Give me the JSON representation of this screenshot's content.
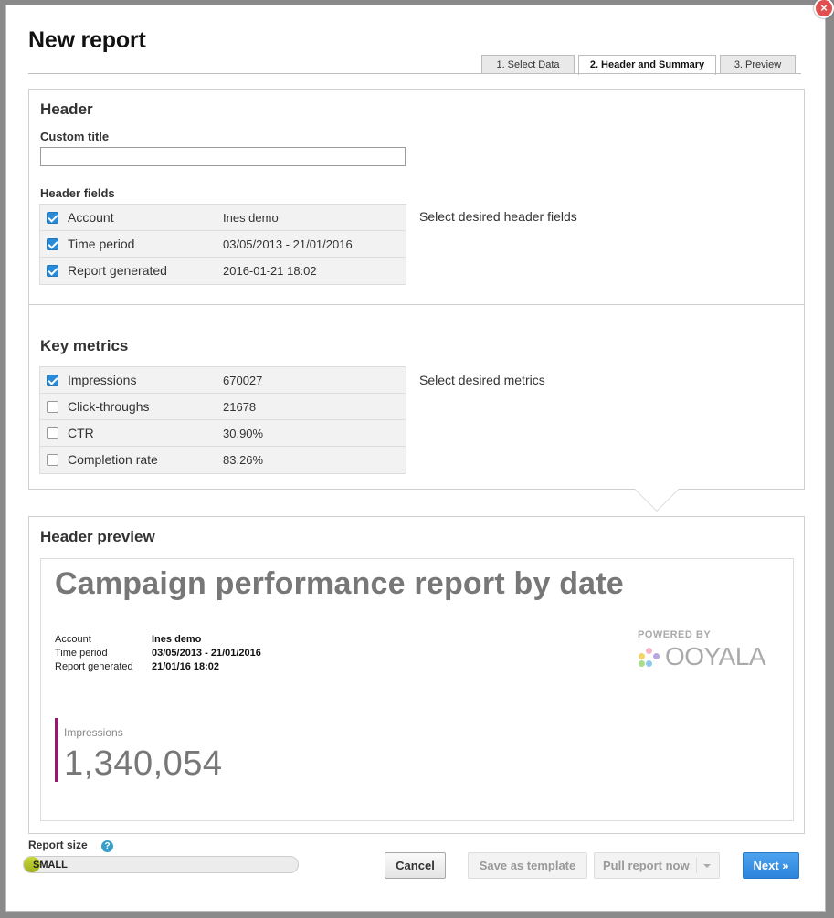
{
  "dialog": {
    "title": "New report",
    "close_glyph": "×"
  },
  "tabs": [
    {
      "label": "1. Select Data",
      "active": false
    },
    {
      "label": "2. Header and Summary",
      "active": true
    },
    {
      "label": "3. Preview",
      "active": false
    }
  ],
  "header_section": {
    "title": "Header",
    "custom_title_label": "Custom title",
    "custom_title_value": "",
    "fields_label": "Header fields",
    "hint": "Select desired header fields",
    "fields": [
      {
        "label": "Account",
        "value": "Ines demo",
        "checked": true
      },
      {
        "label": "Time period",
        "value": "03/05/2013 - 21/01/2016",
        "checked": true
      },
      {
        "label": "Report generated",
        "value": "2016-01-21 18:02",
        "checked": true
      }
    ]
  },
  "metrics_section": {
    "title": "Key metrics",
    "hint": "Select desired metrics",
    "metrics": [
      {
        "label": "Impressions",
        "value": "670027",
        "checked": true
      },
      {
        "label": "Click-throughs",
        "value": "21678",
        "checked": false
      },
      {
        "label": "CTR",
        "value": "30.90%",
        "checked": false
      },
      {
        "label": "Completion rate",
        "value": "83.26%",
        "checked": false
      }
    ]
  },
  "preview_section": {
    "title": "Header preview",
    "report_title": "Campaign performance report by date",
    "info": [
      {
        "label": "Account",
        "value": "Ines demo"
      },
      {
        "label": "Time period",
        "value": "03/05/2013 - 21/01/2016"
      },
      {
        "label": "Report generated",
        "value": "21/01/16 18:02"
      }
    ],
    "powered_by": "POWERED BY",
    "brand": "OOYALA",
    "kpi_label": "Impressions",
    "kpi_value": "1,340,054",
    "kpi_color": "#8b1f6e"
  },
  "footer": {
    "report_size_label": "Report size",
    "help_glyph": "?",
    "size_value": "SMALL",
    "size_fill_fraction": 0.05,
    "cancel_label": "Cancel",
    "save_template_label": "Save as template",
    "pull_report_label": "Pull report now",
    "next_label": "Next »"
  },
  "colors": {
    "accent_blue": "#2b84db",
    "checkbox_blue": "#2b8ad6",
    "size_fill": "#c6d63a"
  }
}
